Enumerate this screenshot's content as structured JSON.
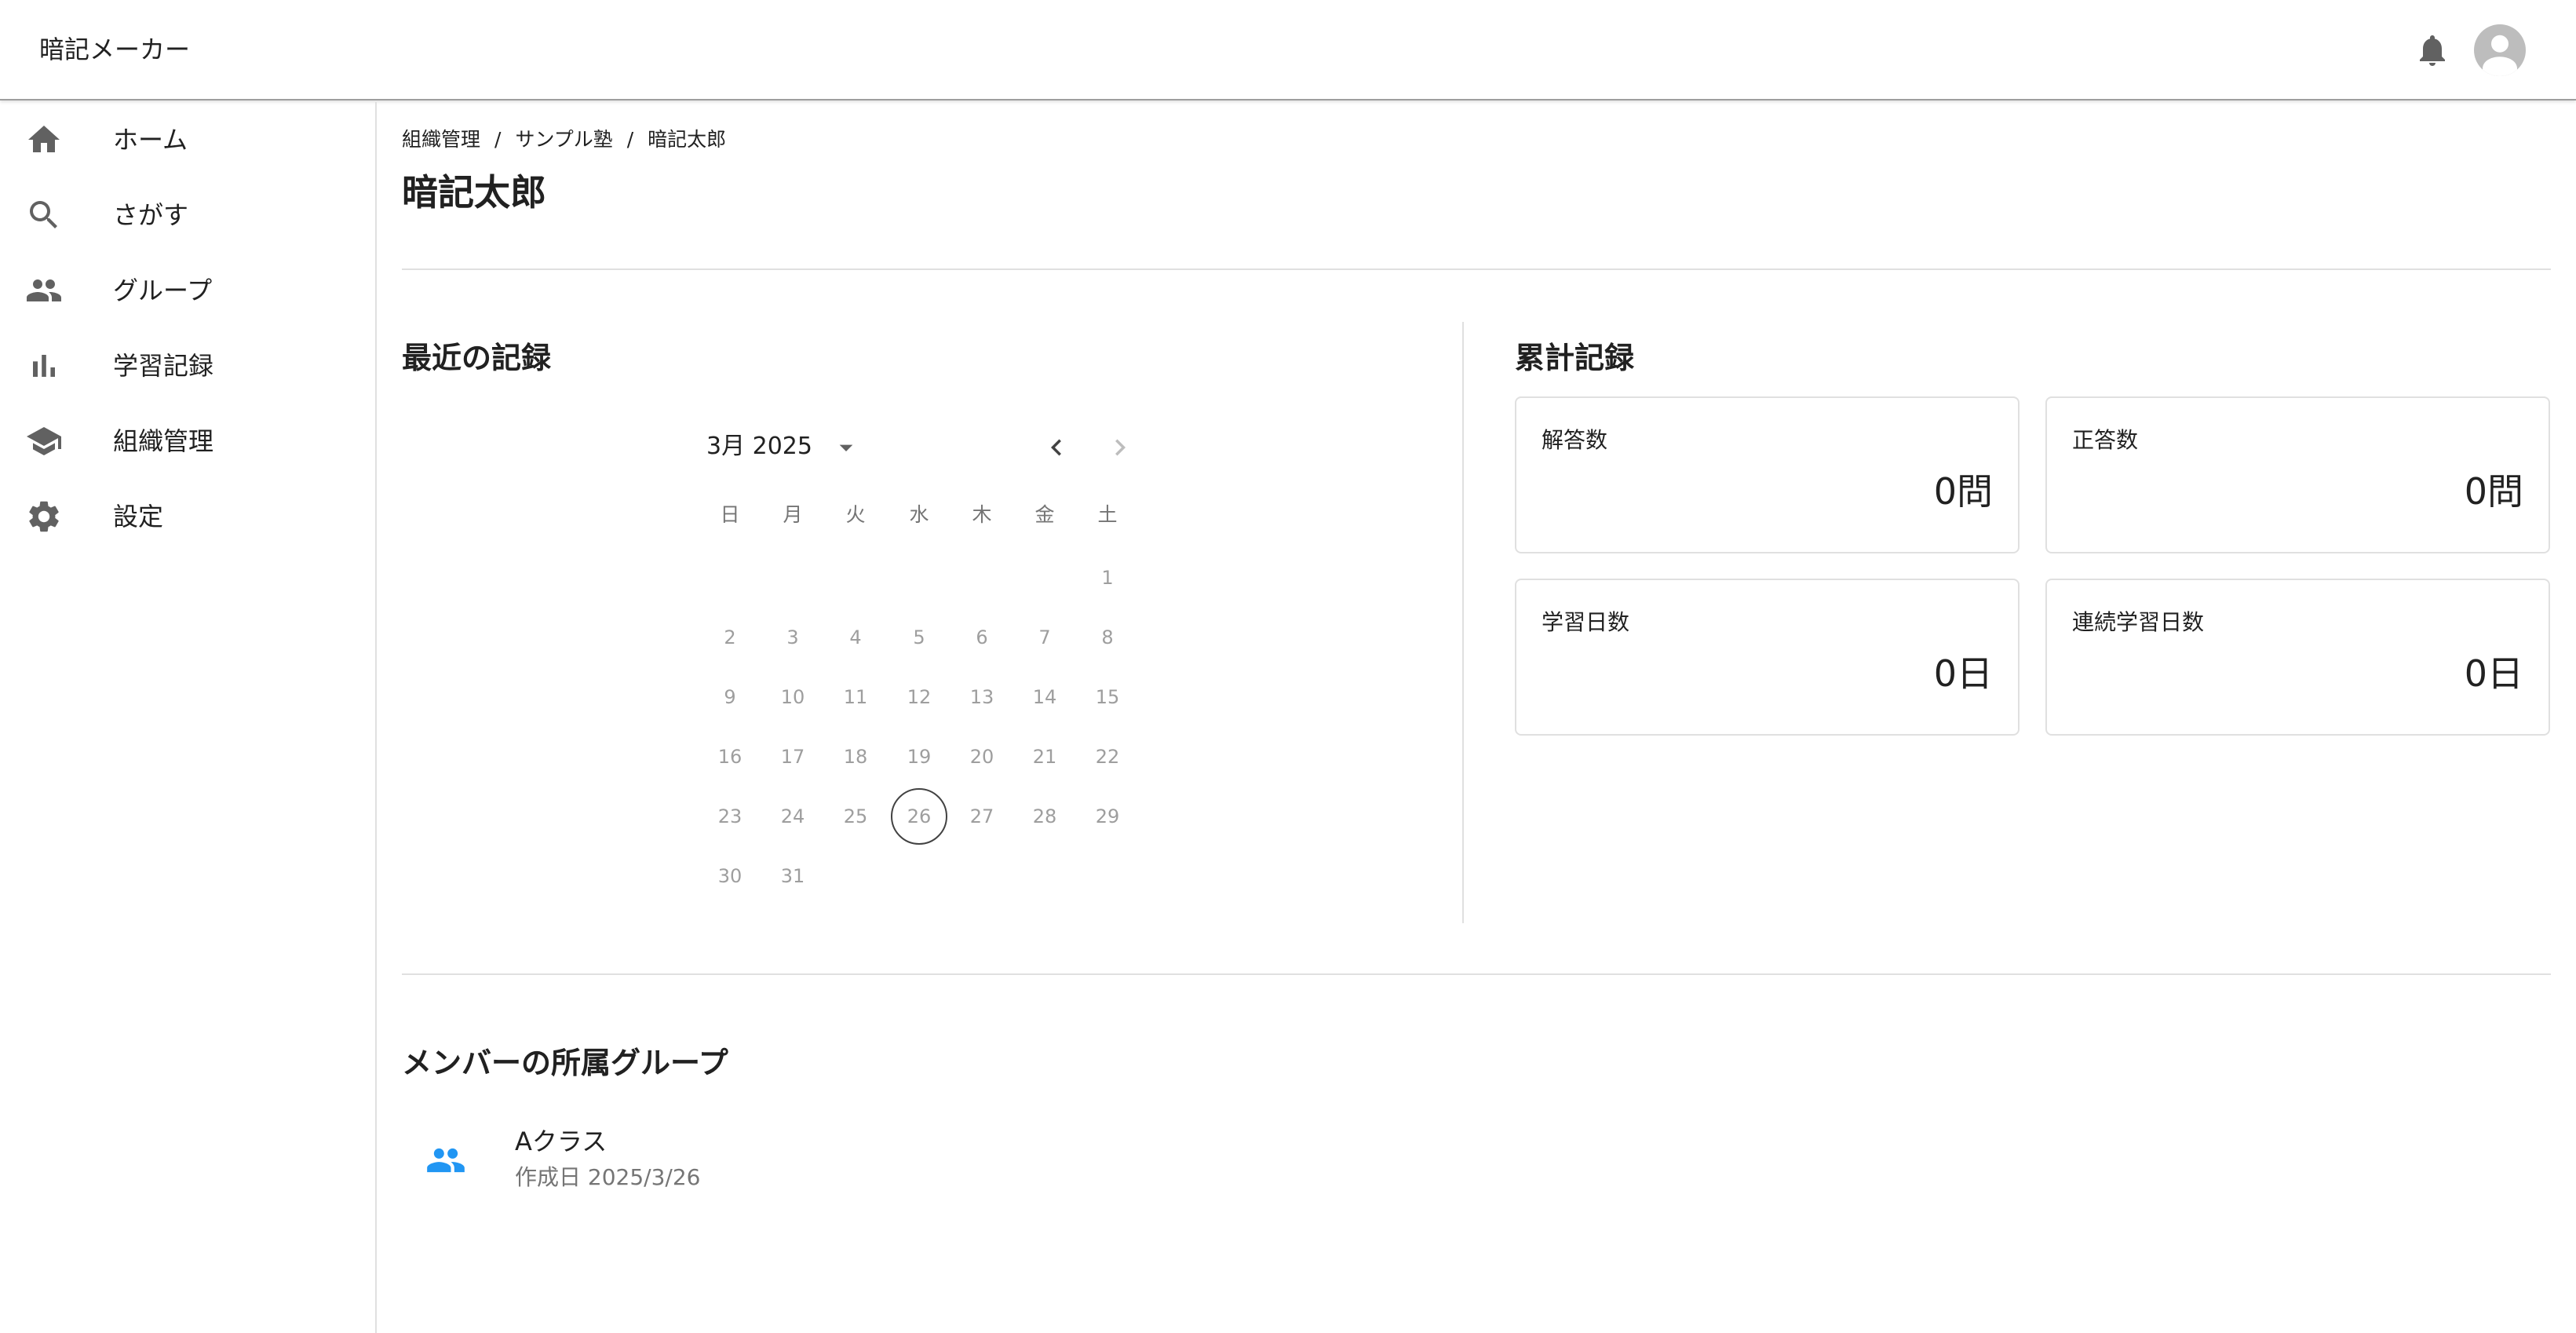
{
  "app": {
    "title": "暗記メーカー"
  },
  "header": {
    "bell_icon": "notifications-icon",
    "avatar_icon": "account-circle-icon"
  },
  "sidebar": {
    "items": [
      {
        "label": "ホーム",
        "icon": "home-icon"
      },
      {
        "label": "さがす",
        "icon": "search-icon"
      },
      {
        "label": "グループ",
        "icon": "people-icon"
      },
      {
        "label": "学習記録",
        "icon": "bar-chart-icon"
      },
      {
        "label": "組織管理",
        "icon": "school-icon"
      },
      {
        "label": "設定",
        "icon": "gear-icon"
      }
    ]
  },
  "breadcrumb": {
    "items": [
      "組織管理",
      "サンプル塾",
      "暗記太郎"
    ],
    "separator": "/"
  },
  "page": {
    "title": "暗記太郎"
  },
  "recent": {
    "title": "最近の記録",
    "calendar": {
      "month_label": "3月 2025",
      "weekdays": [
        "日",
        "月",
        "火",
        "水",
        "木",
        "金",
        "土"
      ],
      "days": [
        "1",
        "2",
        "3",
        "4",
        "5",
        "6",
        "7",
        "8",
        "9",
        "10",
        "11",
        "12",
        "13",
        "14",
        "15",
        "16",
        "17",
        "18",
        "19",
        "20",
        "21",
        "22",
        "23",
        "24",
        "25",
        "26",
        "27",
        "28",
        "29",
        "30",
        "31"
      ],
      "today": "26"
    }
  },
  "totals": {
    "title": "累計記録",
    "cards": [
      {
        "label": "解答数",
        "value": "0問"
      },
      {
        "label": "正答数",
        "value": "0問"
      },
      {
        "label": "学習日数",
        "value": "0日"
      },
      {
        "label": "連続学習日数",
        "value": "0日"
      }
    ]
  },
  "groups": {
    "title": "メンバーの所属グループ",
    "items": [
      {
        "name": "Aクラス",
        "created": "作成日 2025/3/26",
        "icon": "people-icon"
      }
    ]
  },
  "colors": {
    "accent": "#2196f3",
    "icon_gray": "#616161",
    "divider": "#e0e0e0"
  }
}
